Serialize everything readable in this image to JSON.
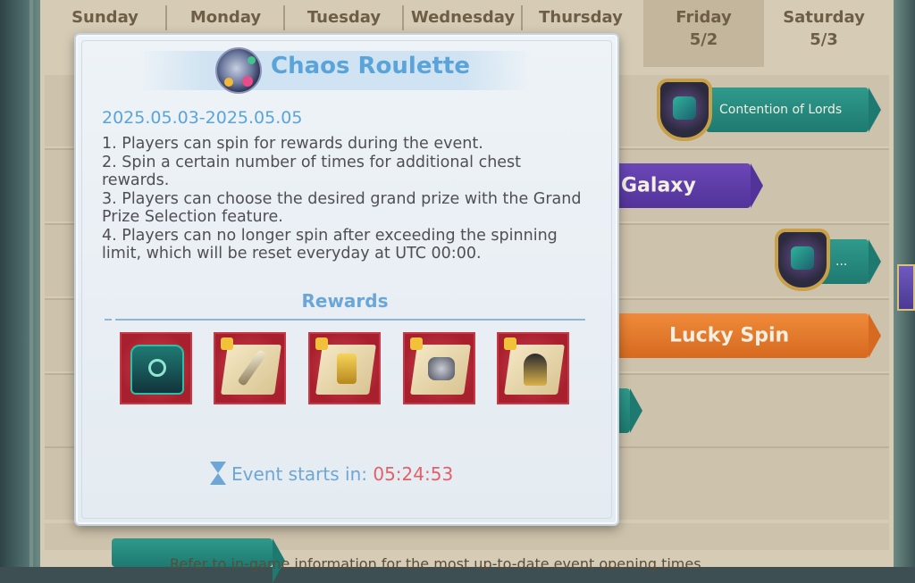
{
  "calendar": {
    "days": [
      {
        "name": "Sunday",
        "date": ""
      },
      {
        "name": "Monday",
        "date": ""
      },
      {
        "name": "Tuesday",
        "date": ""
      },
      {
        "name": "Wednesday",
        "date": ""
      },
      {
        "name": "Thursday",
        "date": ""
      },
      {
        "name": "Friday",
        "date": "5/2"
      },
      {
        "name": "Saturday",
        "date": "5/3"
      }
    ],
    "events": {
      "contention": "Contention of Lords",
      "galaxy": "Galaxy",
      "ellipsis": "...",
      "lucky_spin": "Lucky Spin"
    },
    "footer": "Refer to in-game information for the most up-to-date event opening times."
  },
  "popup": {
    "title": "Chaos Roulette",
    "title_icon": "roulette-wheel-icon",
    "dates": "2025.05.03-2025.05.05",
    "rules": [
      "1. Players can spin for rewards during the event.",
      "2. Spin a certain number of times for additional chest rewards.",
      "3. Players can choose the desired grand prize with the Grand Prize Selection feature.",
      "4. Players can no longer spin after exceeding the spinning limit, which will be reset everyday at UTC 00:00."
    ],
    "rewards_title": "Rewards",
    "rewards": [
      {
        "icon": "teal-chest-icon"
      },
      {
        "icon": "spear-fragment-icon"
      },
      {
        "icon": "golden-blade-fragment-icon"
      },
      {
        "icon": "stone-fragment-icon"
      },
      {
        "icon": "horned-helmet-fragment-icon"
      }
    ],
    "timer_label": "Event starts in:",
    "timer_value": "05:24:53"
  },
  "colors": {
    "popup_title": "#5aa4da",
    "timer_value": "#e4606a",
    "reward_frame": "#c63a48"
  }
}
